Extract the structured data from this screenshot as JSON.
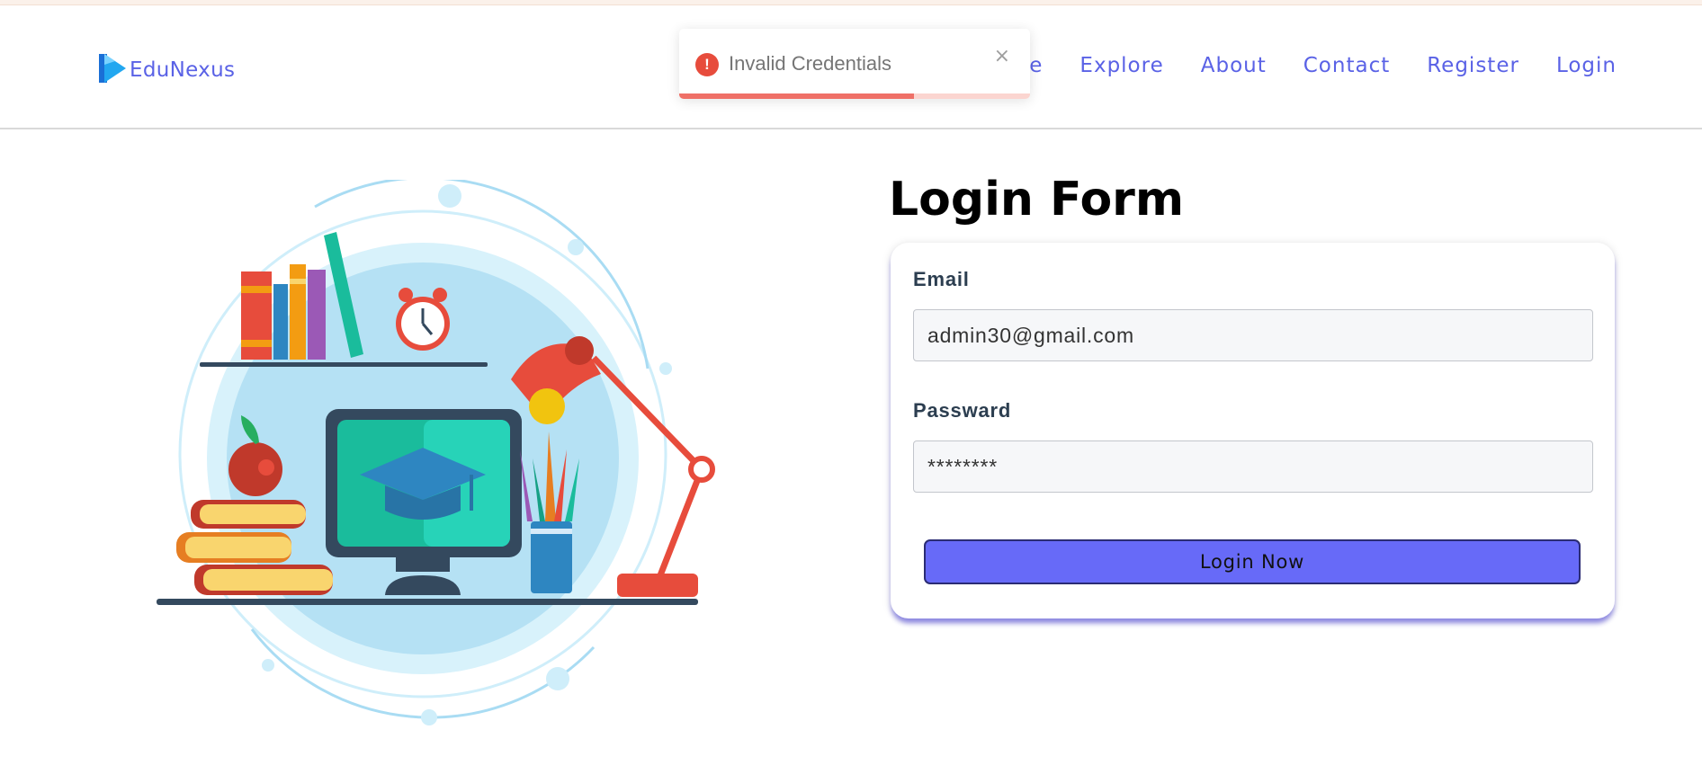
{
  "brand": {
    "name": "EduNexus",
    "logo_icon": "play-logo-icon"
  },
  "nav": {
    "items": [
      {
        "label": "e"
      },
      {
        "label": "Explore"
      },
      {
        "label": "About"
      },
      {
        "label": "Contact"
      },
      {
        "label": "Register"
      },
      {
        "label": "Login"
      }
    ]
  },
  "toast": {
    "message": "Invalid Credentials",
    "close_glyph": "×",
    "icon_glyph": "!",
    "progress": 0.67,
    "color": "#e74c3c"
  },
  "form": {
    "title": "Login Form",
    "email_label": "Email",
    "email_value": "admin30@gmail.com",
    "password_label": "Passward",
    "password_value": "********",
    "submit_label": "Login Now"
  },
  "colors": {
    "accent": "#5a62e6",
    "button": "#676af8",
    "error": "#e74c3c"
  }
}
